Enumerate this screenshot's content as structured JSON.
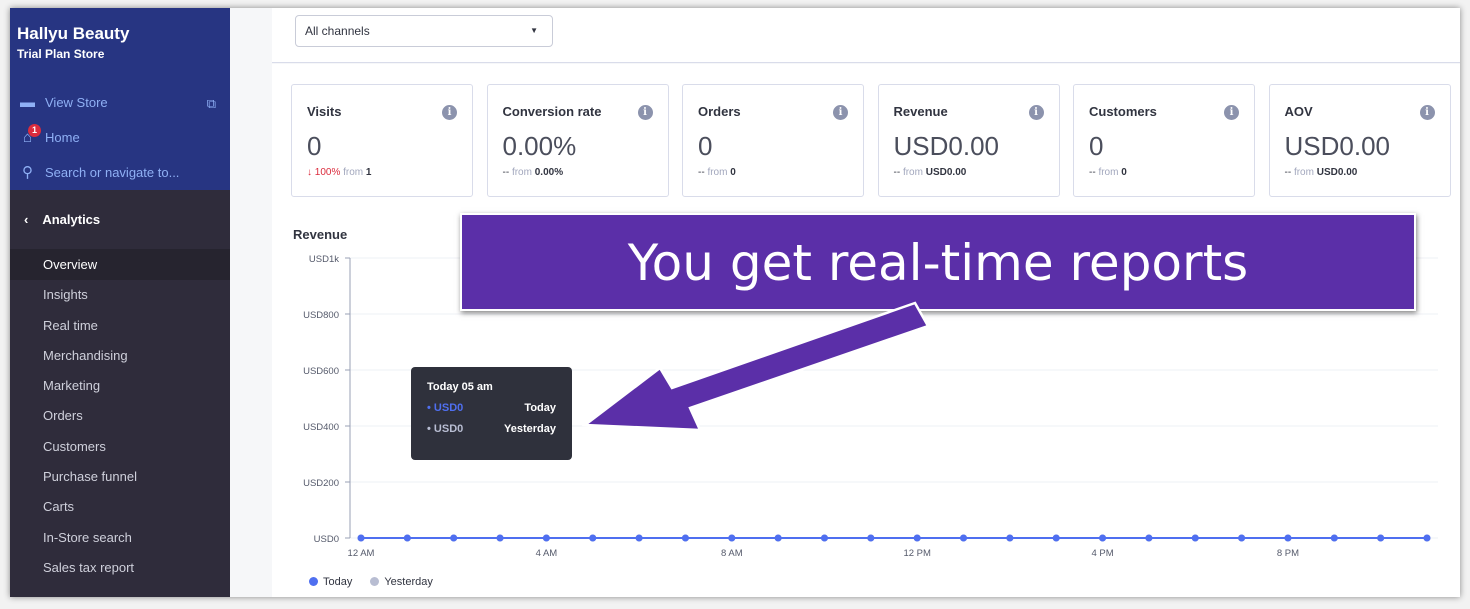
{
  "sidebar": {
    "store_name": "Hallyu Beauty",
    "store_plan": "Trial Plan Store",
    "view_store": "View Store",
    "home": "Home",
    "home_badge": "1",
    "search": "Search or navigate to...",
    "section": "Analytics",
    "items": [
      "Overview",
      "Insights",
      "Real time",
      "Merchandising",
      "Marketing",
      "Orders",
      "Customers",
      "Purchase funnel",
      "Carts",
      "In-Store search",
      "Sales tax report"
    ],
    "active": "Overview"
  },
  "filter": {
    "channel": "All channels"
  },
  "cards": [
    {
      "title": "Visits",
      "value": "0",
      "change": "100%",
      "change_dir": "down",
      "from_label": "from",
      "from": "1"
    },
    {
      "title": "Conversion rate",
      "value": "0.00%",
      "change": "--",
      "from_label": "from",
      "from": "0.00%"
    },
    {
      "title": "Orders",
      "value": "0",
      "change": "--",
      "from_label": "from",
      "from": "0"
    },
    {
      "title": "Revenue",
      "value": "USD0.00",
      "change": "--",
      "from_label": "from",
      "from": "USD0.00"
    },
    {
      "title": "Customers",
      "value": "0",
      "change": "--",
      "from_label": "from",
      "from": "0"
    },
    {
      "title": "AOV",
      "value": "USD0.00",
      "change": "--",
      "from_label": "from",
      "from": "USD0.00"
    }
  ],
  "tooltip": {
    "title": "Today 05 am",
    "rows": [
      {
        "value": "USD0",
        "label": "Today"
      },
      {
        "value": "USD0",
        "label": "Yesterday"
      }
    ]
  },
  "callout": "You get real-time reports",
  "colors": {
    "today": "#4f6ff0",
    "yesterday": "#b8bdd2",
    "accent": "#5b2fa8",
    "sidebar_top": "#273582"
  },
  "chart_data": {
    "type": "line",
    "title": "Revenue",
    "ylim": [
      0,
      1000
    ],
    "yticks": [
      "USD0",
      "USD200",
      "USD400",
      "USD600",
      "USD800",
      "USD1k"
    ],
    "ytick_values": [
      0,
      200,
      400,
      600,
      800,
      1000
    ],
    "xticks": [
      "12 AM",
      "4 AM",
      "8 AM",
      "12 PM",
      "4 PM",
      "8 PM"
    ],
    "xtick_hours": [
      0,
      4,
      8,
      12,
      16,
      20
    ],
    "x_hours": [
      0,
      1,
      2,
      3,
      4,
      5,
      6,
      7,
      8,
      9,
      10,
      11,
      12,
      13,
      14,
      15,
      16,
      17,
      18,
      19,
      20,
      21,
      22,
      23
    ],
    "series": [
      {
        "name": "Today",
        "values": [
          0,
          0,
          0,
          0,
          0,
          0,
          0,
          0,
          0,
          0,
          0,
          0,
          0,
          0,
          0,
          0,
          0,
          0,
          0,
          0,
          0,
          0,
          0,
          0
        ]
      },
      {
        "name": "Yesterday",
        "values": [
          0,
          0,
          0,
          0,
          0,
          0,
          0,
          0,
          0,
          0,
          0,
          0,
          0,
          0,
          0,
          0,
          0,
          0,
          0,
          0,
          0,
          0,
          0,
          0
        ]
      }
    ],
    "grid": true,
    "legend": "bottom-left"
  }
}
